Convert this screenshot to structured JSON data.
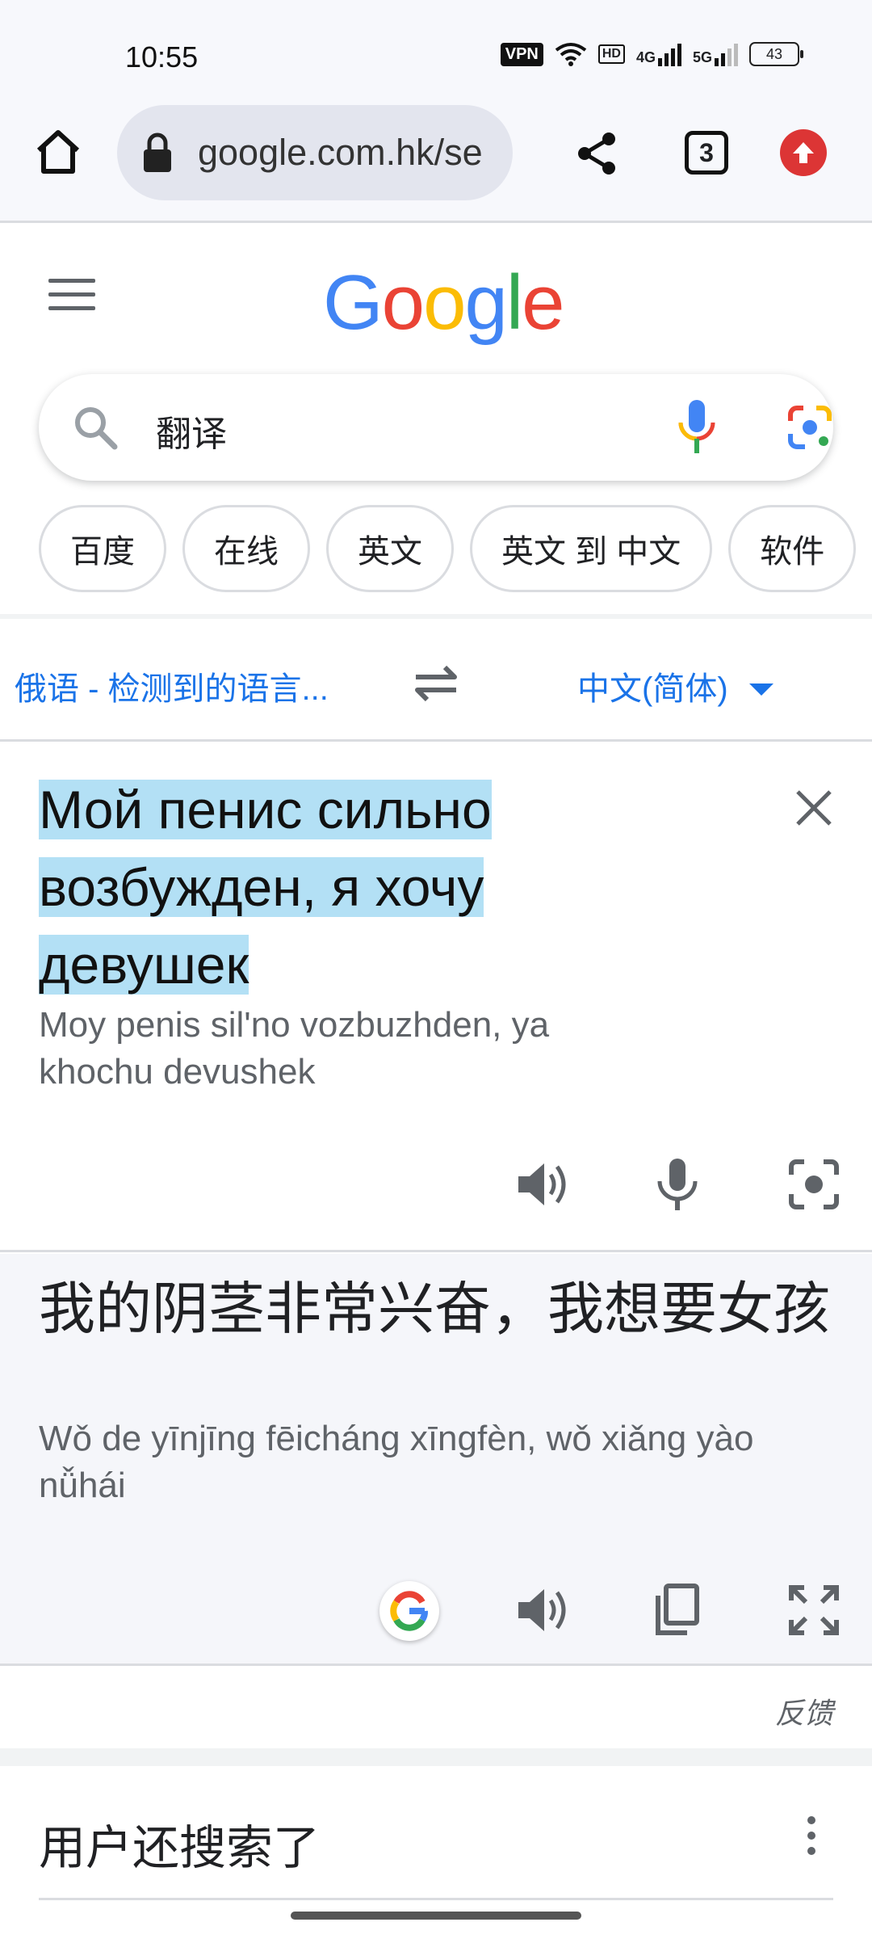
{
  "status_bar": {
    "time": "10:55",
    "vpn": "VPN",
    "hd": "HD",
    "net1": "4G",
    "net2": "5G",
    "battery": "43"
  },
  "browser": {
    "url": "google.com.hk/se",
    "tab_count": "3"
  },
  "google": {
    "logo": [
      "G",
      "o",
      "o",
      "g",
      "l",
      "e"
    ],
    "logo_colors": [
      "#4285F4",
      "#EA4335",
      "#FBBC05",
      "#4285F4",
      "#34A853",
      "#EA4335"
    ],
    "query": "翻译"
  },
  "chips": [
    "百度",
    "在线",
    "英文",
    "英文 到 中文",
    "软件"
  ],
  "translate": {
    "source_lang": "俄语 - 检测到的语言...",
    "target_lang": "中文(简体)",
    "source_lines": [
      "Мой пенис сильно",
      "возбужден, я хочу",
      "девушек"
    ],
    "source_translit": "Moy penis sil'no vozbuzhden, ya khochu devushek",
    "target_text": "我的阴茎非常兴奋，我想要女孩",
    "target_pinyin": "Wǒ de yīnjīng fēicháng xīngfèn, wǒ xiǎng yào nǚhái",
    "feedback": "反馈"
  },
  "also_searched": {
    "title": "用户还搜索了"
  }
}
